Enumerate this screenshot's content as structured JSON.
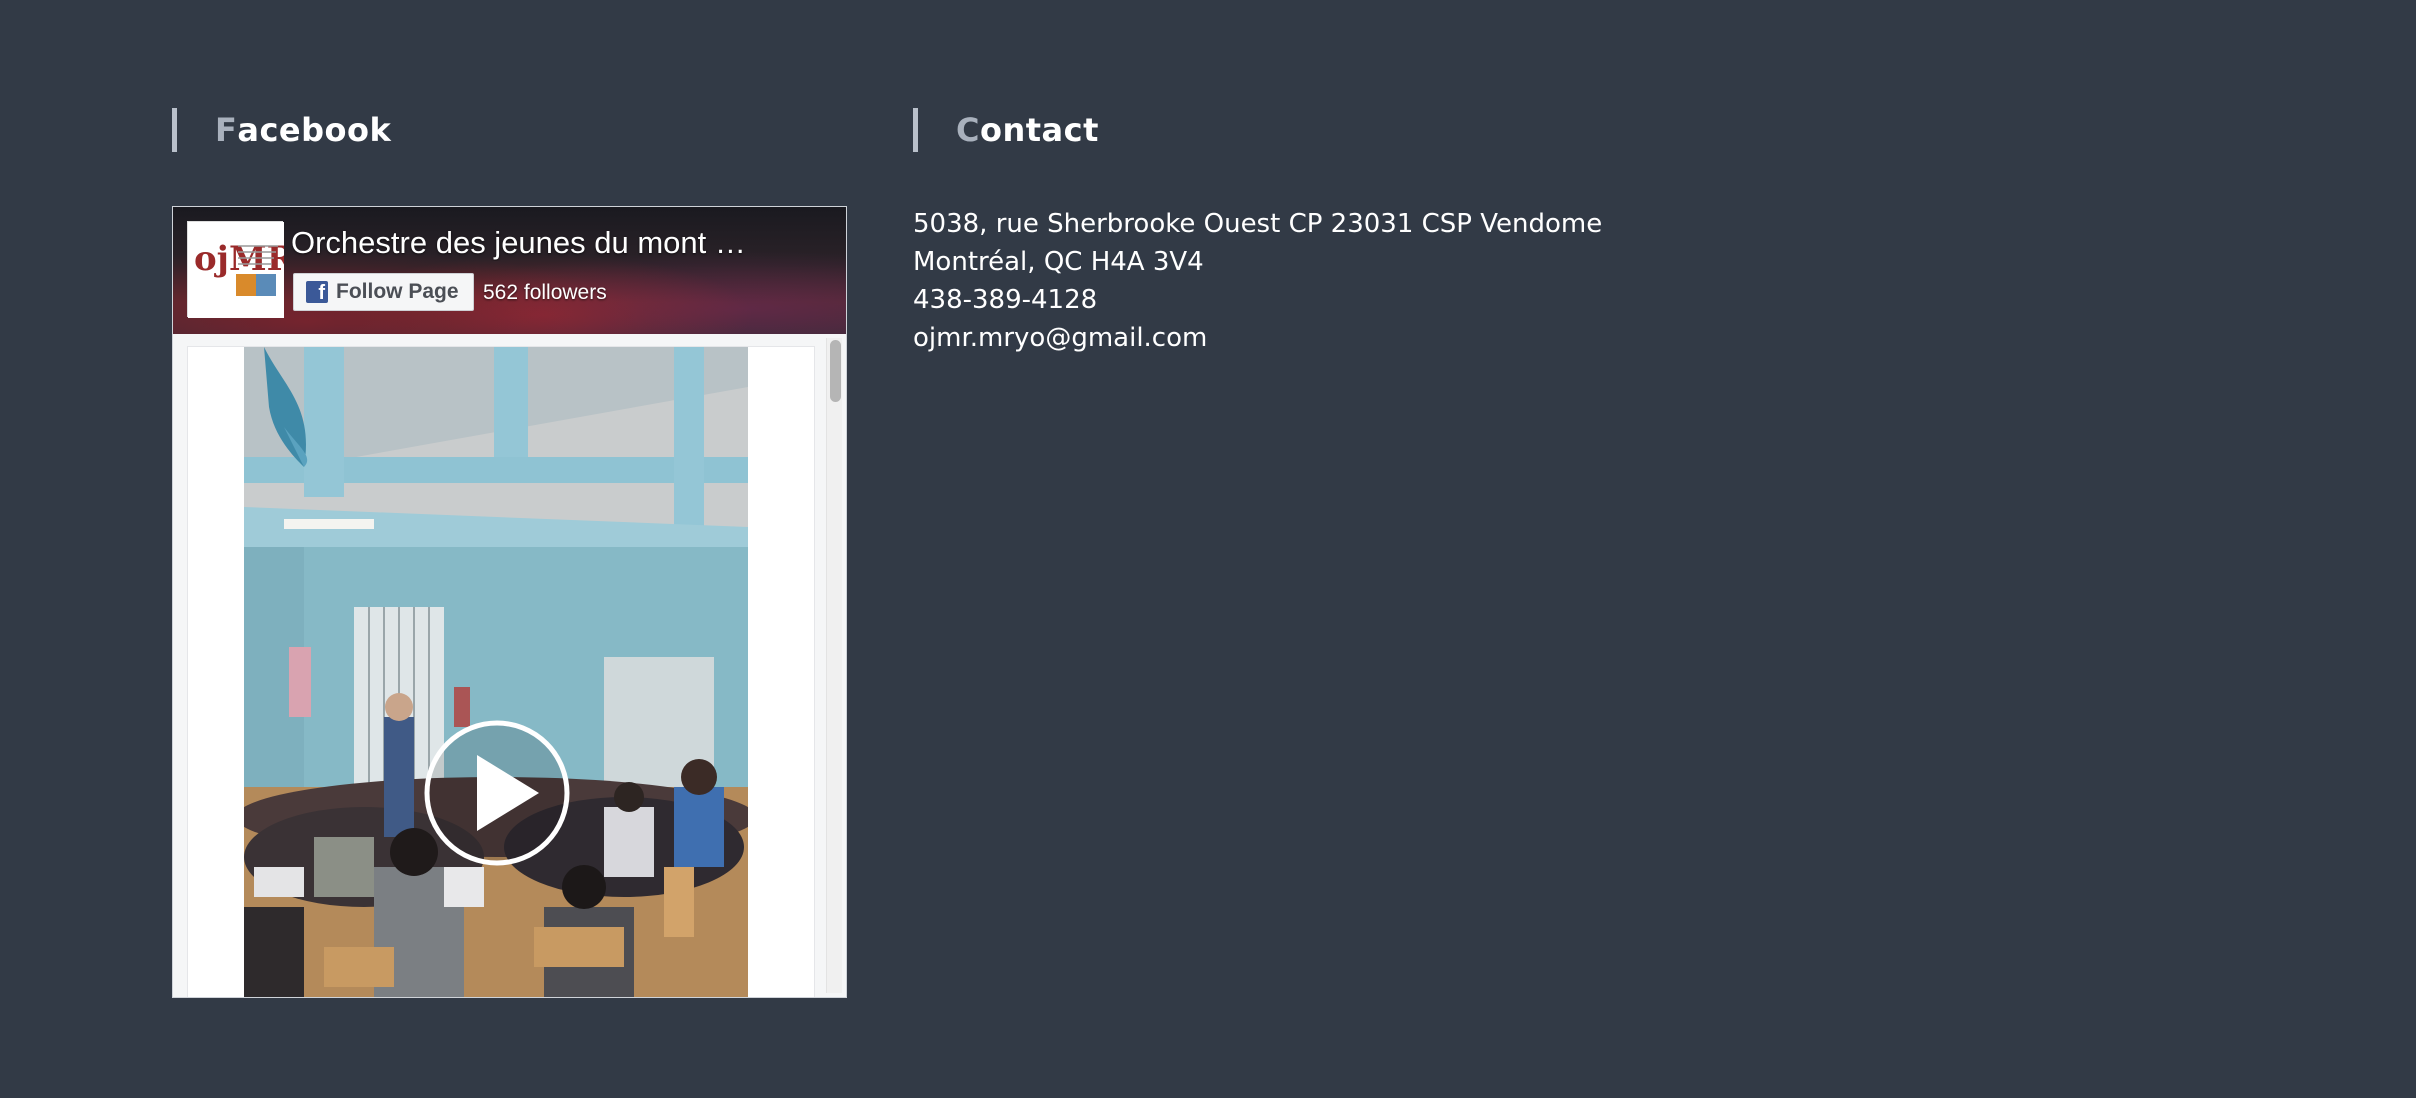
{
  "facebook_section": {
    "heading_first": "F",
    "heading_rest": "acebook",
    "widget": {
      "page_name": "Orchestre des jeunes du mont …",
      "follow_button_label": "Follow Page",
      "followers": "562 followers",
      "fb_glyph": "f",
      "avatar_logo_text": "ojMR"
    }
  },
  "contact_section": {
    "heading_first": "C",
    "heading_rest": "ontact",
    "address_line1": "5038, rue Sherbrooke Ouest CP 23031 CSP Vendome",
    "address_line2": "Montréal, QC H4A 3V4",
    "phone": "438-389-4128",
    "email": "ojmr.mryo@gmail.com"
  },
  "colors": {
    "background": "#323a46",
    "heading_accent": "#a9b1bd",
    "facebook_blue": "#3b5998"
  },
  "icons": [
    "facebook-f-icon",
    "play-icon"
  ]
}
